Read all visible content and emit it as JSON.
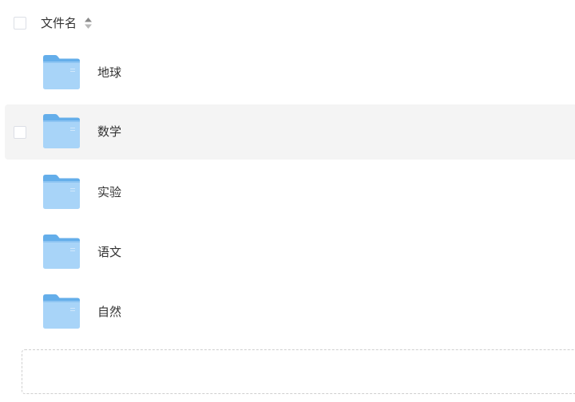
{
  "header": {
    "filename_label": "文件名"
  },
  "icons": {
    "folder": "folder-icon",
    "sort": "sort-icon",
    "checkbox": "checkbox"
  },
  "colors": {
    "folder_light": "#a8d4f8",
    "folder_dark": "#64aeea",
    "row_hover_bg": "#f4f4f4",
    "checkbox_border": "#dcdfe6",
    "text": "#333333"
  },
  "rows": [
    {
      "name": "地球",
      "hover": false
    },
    {
      "name": "数学",
      "hover": true
    },
    {
      "name": "实验",
      "hover": false
    },
    {
      "name": "语文",
      "hover": false
    },
    {
      "name": "自然",
      "hover": false
    }
  ]
}
